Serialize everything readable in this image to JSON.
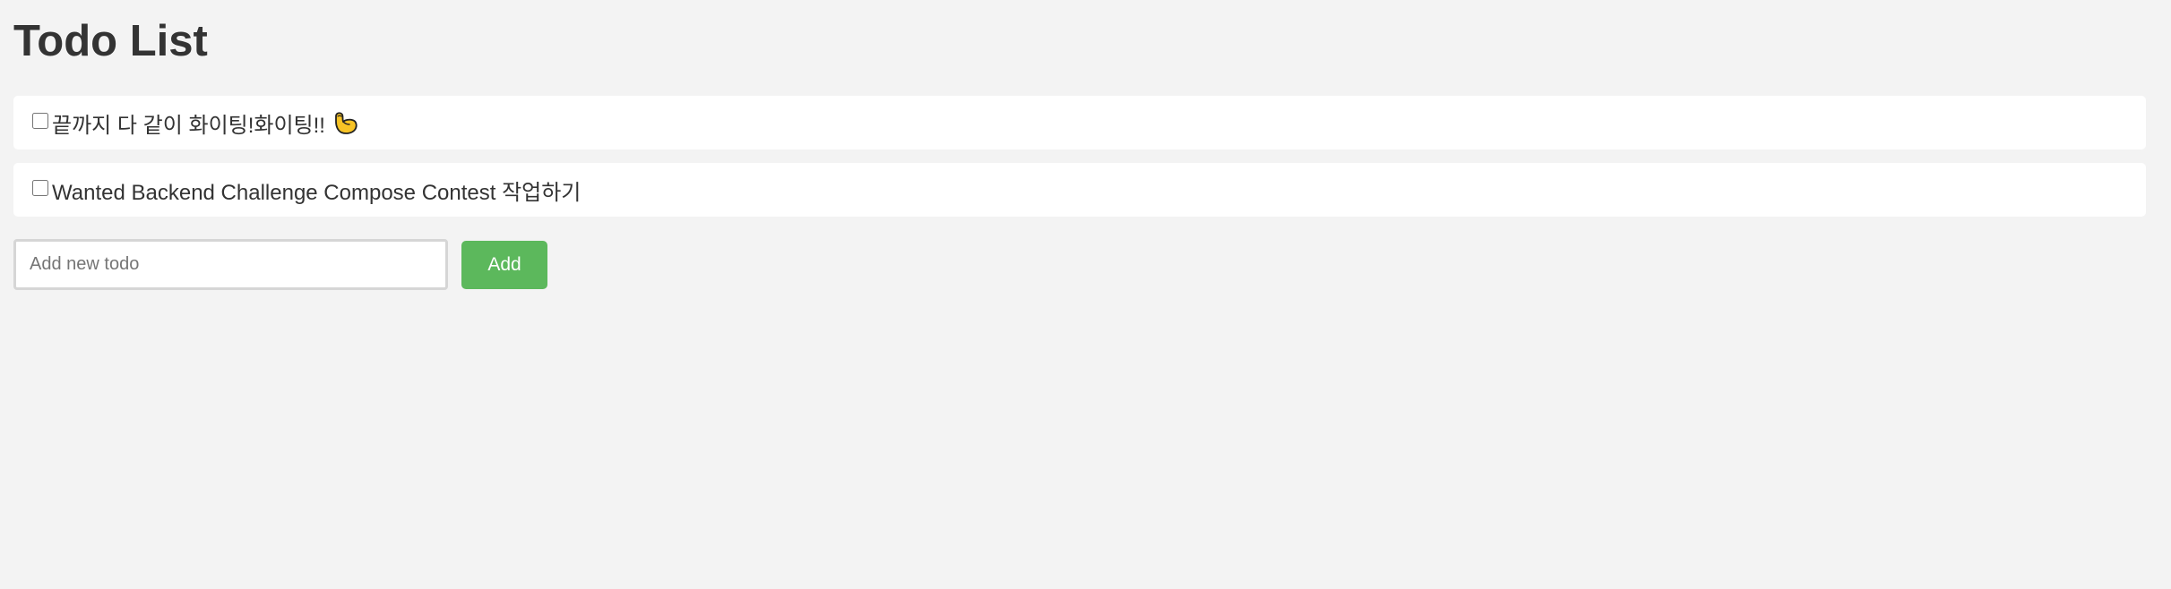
{
  "header": {
    "title": "Todo List"
  },
  "todos": [
    {
      "text": "끝까지 다 같이 화이팅!화이팅!!",
      "checked": false,
      "trailing_icon": "flexed-biceps-icon"
    },
    {
      "text": "Wanted Backend Challenge Compose Contest 작업하기",
      "checked": false
    }
  ],
  "add_form": {
    "placeholder": "Add new todo",
    "value": "",
    "button_label": "Add"
  },
  "colors": {
    "background": "#f3f3f3",
    "card": "#ffffff",
    "text": "#333333",
    "button": "#5cb85c",
    "button_text": "#ffffff",
    "input_border": "#d6d6d6"
  }
}
